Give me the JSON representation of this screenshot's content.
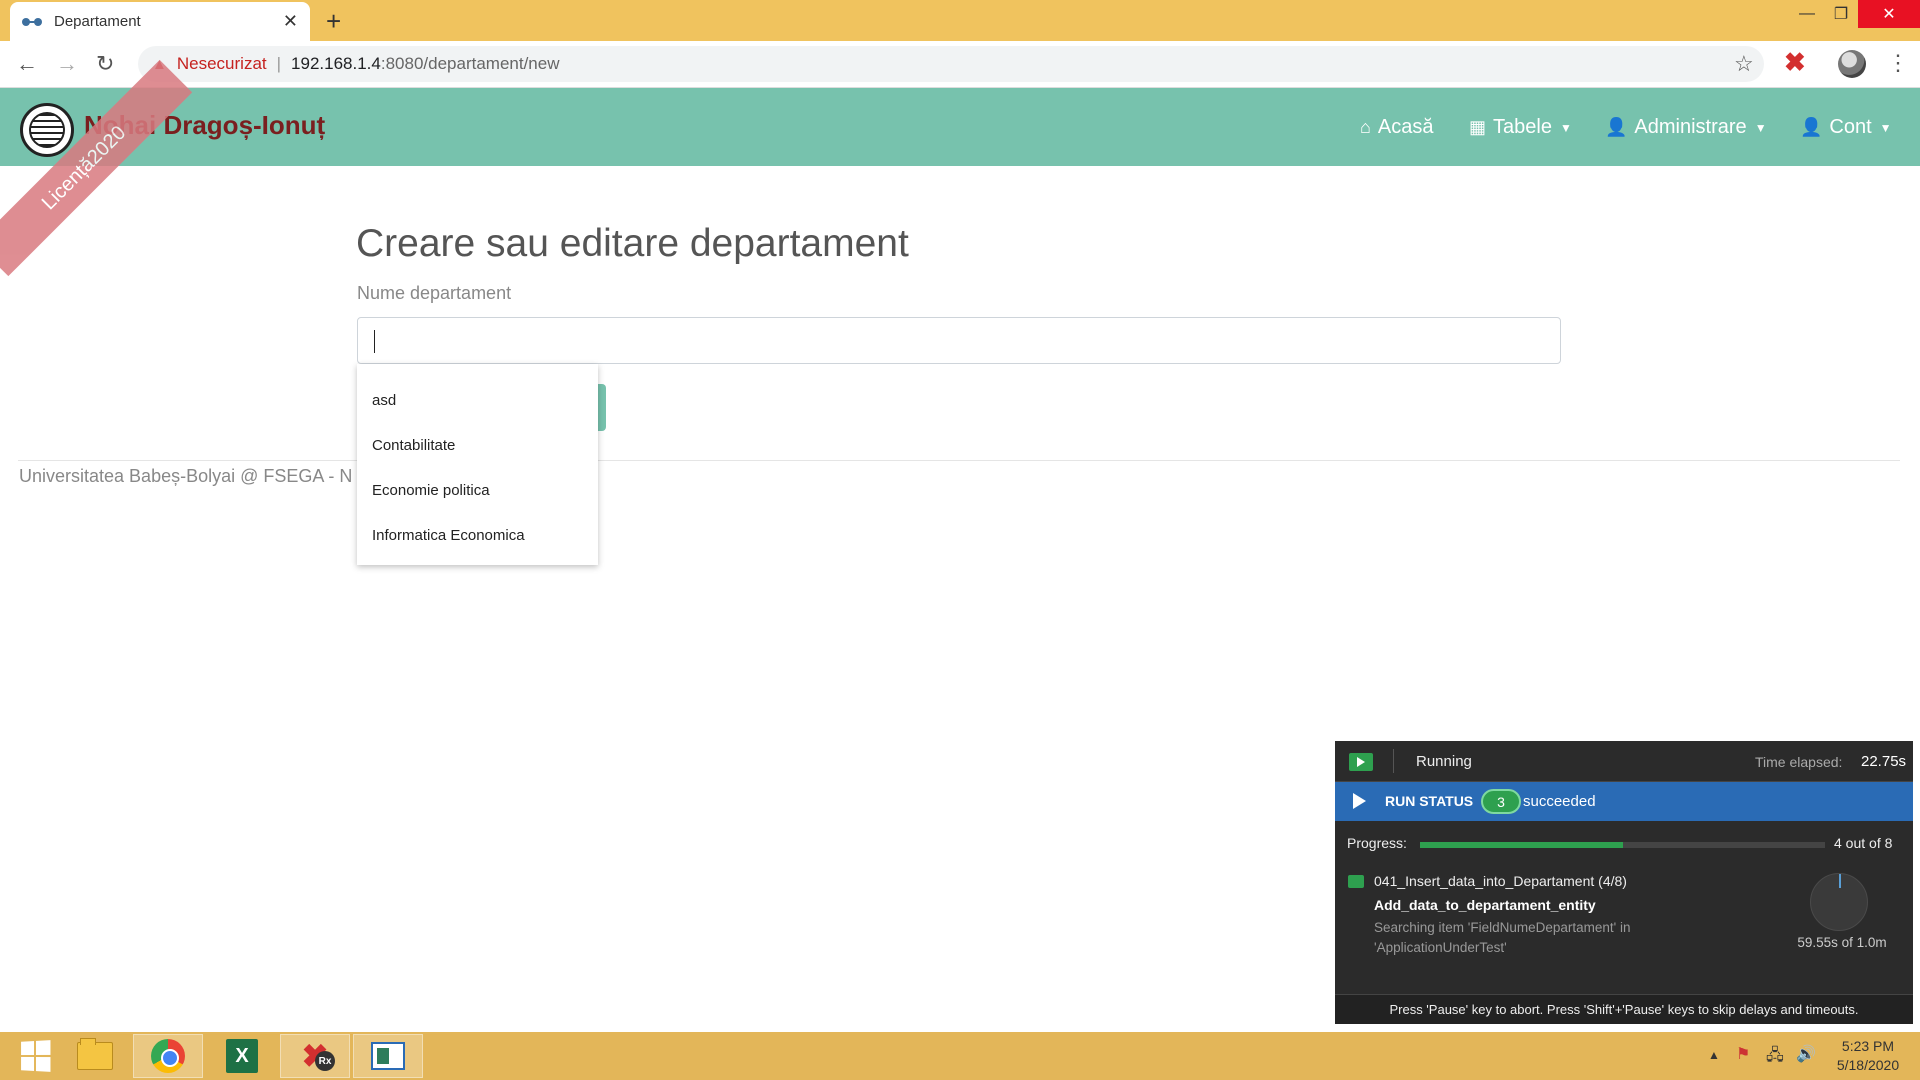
{
  "browser": {
    "tab_title": "Departament",
    "tab_close": "✕",
    "new_tab": "+",
    "url_security": "Nesecurizat",
    "url_host": "192.168.1.4",
    "url_path": ":8080/departament/new",
    "window_controls": {
      "minimize": "—",
      "maximize": "❐",
      "close": "✕"
    }
  },
  "app": {
    "brand": "Nohai Dragoș-Ionuț",
    "ribbon": "Licență2020",
    "nav": [
      {
        "label": "Acasă",
        "icon": "home-icon"
      },
      {
        "label": "Tabele",
        "icon": "table-icon",
        "dropdown": true
      },
      {
        "label": "Administrare",
        "icon": "user-plus-icon",
        "dropdown": true
      },
      {
        "label": "Cont",
        "icon": "user-icon",
        "dropdown": true
      }
    ]
  },
  "form": {
    "title": "Creare sau editare departament",
    "field_label": "Nume departament",
    "field_value": "",
    "autocomplete": [
      "asd",
      "Contabilitate",
      "Economie politica",
      "Informatica Economica"
    ]
  },
  "footer": {
    "text": "Universitatea Babeș-Bolyai @ FSEGA - N"
  },
  "run_panel": {
    "state": "Running",
    "elapsed_label": "Time elapsed:",
    "elapsed": "22.75s",
    "status_label": "RUN STATUS",
    "succeeded_count": "3",
    "succeeded_label": "succeeded",
    "progress_label": "Progress:",
    "progress_text": "4 out of 8",
    "progress_fraction": 0.5,
    "item_title": "041_Insert_data_into_Departament (4/8)",
    "item_sub": "Add_data_to_departament_entity",
    "item_desc": "Searching item 'FieldNumeDepartament' in 'ApplicationUnderTest'",
    "timer": "59.55s of 1.0m",
    "footer": "Press 'Pause' key to abort. Press 'Shift'+'Pause' keys to skip delays and timeouts."
  },
  "taskbar": {
    "time": "5:23 PM",
    "date": "5/18/2020",
    "excel_glyph": "X",
    "ranorex_glyph": "✖",
    "ranorex_badge": "Rx"
  }
}
